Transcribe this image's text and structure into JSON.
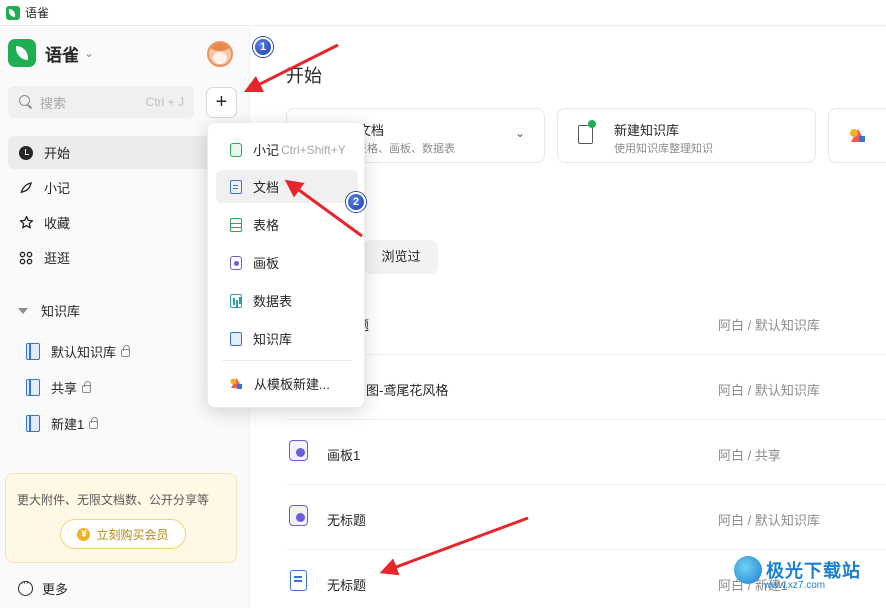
{
  "window": {
    "title": "语雀"
  },
  "sidebar": {
    "brand": "语雀",
    "search": {
      "placeholder": "搜索",
      "shortcut": "Ctrl + J"
    },
    "add_button": "+",
    "nav": [
      {
        "label": "开始",
        "icon": "clock-icon",
        "active": true
      },
      {
        "label": "小记",
        "icon": "feather-icon"
      },
      {
        "label": "收藏",
        "icon": "star-icon"
      },
      {
        "label": "逛逛",
        "icon": "grid-icon"
      }
    ],
    "knowledge_header": "知识库",
    "knowledge_bases": [
      {
        "label": "默认知识库"
      },
      {
        "label": "共享"
      },
      {
        "label": "新建1"
      }
    ],
    "promo": {
      "text": "更大附件、无限文档数、公开分享等",
      "button": "立刻购买会员"
    },
    "more": "更多"
  },
  "main": {
    "title": "开始",
    "cards": [
      {
        "title": "建文档",
        "subtitle": "、表格、画板、数据表"
      },
      {
        "title": "新建知识库",
        "subtitle": "使用知识库整理知识"
      }
    ],
    "filter_tab": "浏览过",
    "rows": [
      {
        "name": "题",
        "path": "阿白 / 默认知识库"
      },
      {
        "name": "图-鸢尾花风格",
        "path": "阿白 / 默认知识库"
      },
      {
        "name": "画板1",
        "path": "阿白 / 共享",
        "icon": "board-icon"
      },
      {
        "name": "无标题",
        "path": "阿白 / 默认知识库",
        "icon": "board-icon"
      },
      {
        "name": "无标题",
        "path": "阿白 / 新建1",
        "icon": "doc-icon"
      }
    ]
  },
  "menu": {
    "items": [
      {
        "label": "小记",
        "shortcut": "Ctrl+Shift+Y",
        "icon": "note-icon"
      },
      {
        "label": "文档",
        "icon": "doc-icon",
        "hover": true
      },
      {
        "label": "表格",
        "icon": "sheet-icon"
      },
      {
        "label": "画板",
        "icon": "board-icon"
      },
      {
        "label": "数据表",
        "icon": "table-icon"
      },
      {
        "label": "知识库",
        "icon": "knowledge-base-icon"
      },
      {
        "label": "从模板新建...",
        "icon": "template-icon"
      }
    ]
  },
  "annotations": {
    "badge1": "1",
    "badge2": "2"
  },
  "watermark": {
    "name": "极光下载站",
    "url": "www.xz7.com"
  },
  "colors": {
    "brand_green": "#1fae51",
    "annotation_red": "#e8242a",
    "badge_blue": "#1a3fb0"
  }
}
